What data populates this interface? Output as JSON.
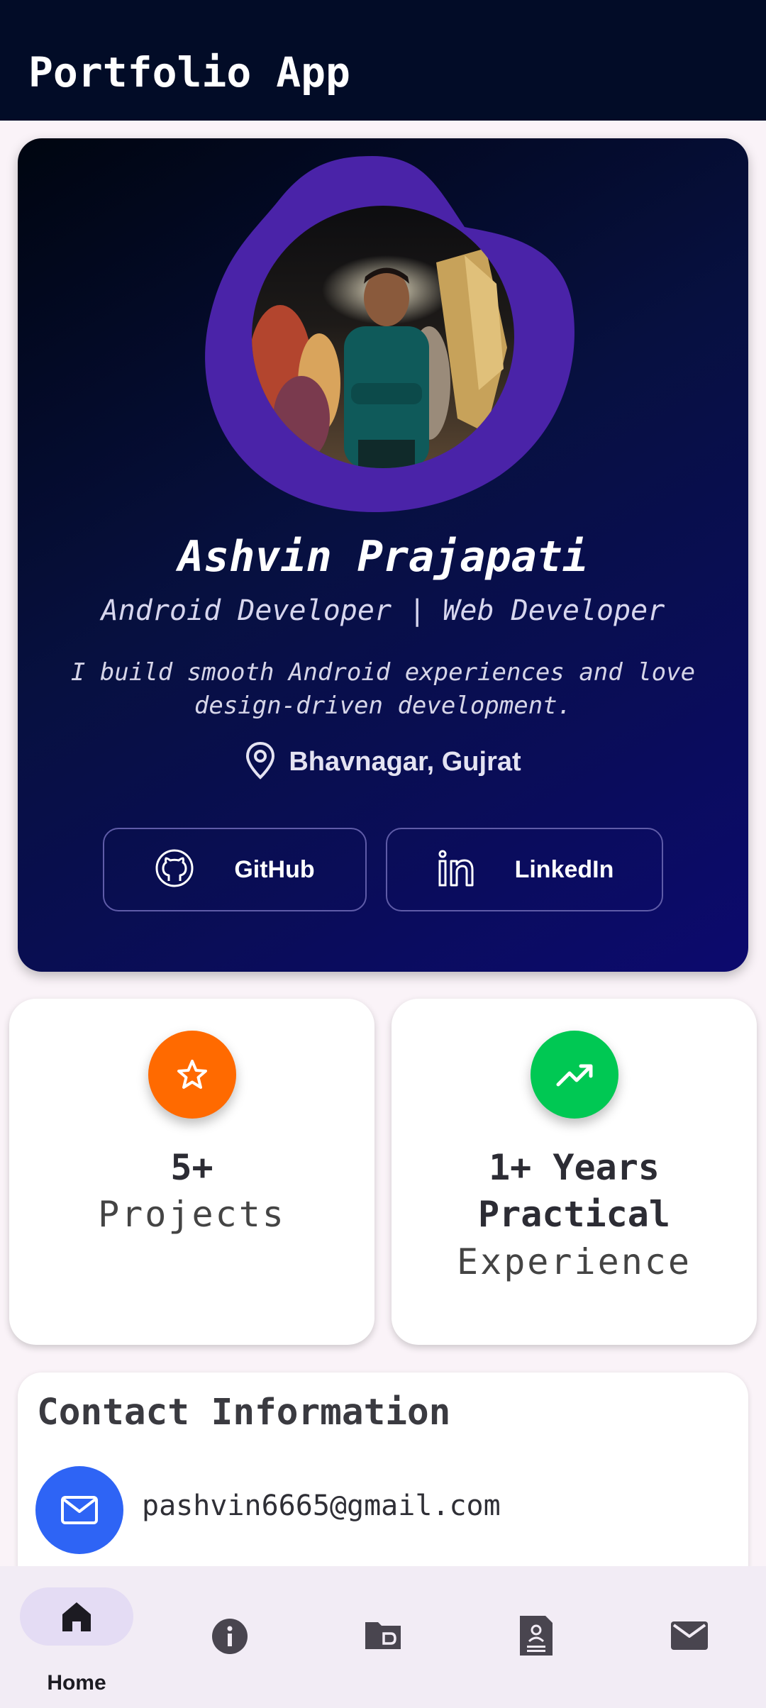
{
  "app_bar": {
    "title": "Portfolio App"
  },
  "profile": {
    "name": "Ashvin Prajapati",
    "role": "Android Developer | Web Developer",
    "bio": "I build smooth Android experiences and love design-driven development.",
    "location": "Bhavnagar, Gujrat",
    "icons": {
      "location": "location-pin-icon"
    },
    "links": [
      {
        "label": "GitHub",
        "icon": "github-icon"
      },
      {
        "label": "LinkedIn",
        "icon": "linkedin-icon"
      }
    ],
    "colors": {
      "blob": "#4a23a8",
      "card_gradient_end": "#0c0a6e"
    }
  },
  "stats": [
    {
      "main": "5+",
      "sub": "Projects",
      "icon": "star-icon",
      "color": "#ff6a00"
    },
    {
      "main_lines": [
        "1+ Years",
        "Practical"
      ],
      "sub": "Experience",
      "icon": "trending-up-icon",
      "color": "#00c853"
    }
  ],
  "contact": {
    "title": "Contact Information",
    "email": "pashvin6665@gmail.com",
    "email_icon": "mail-icon",
    "icon_color": "#2e64f5"
  },
  "bottom_nav": {
    "items": [
      {
        "label": "Home",
        "icon": "home-icon",
        "selected": true
      },
      {
        "label": "",
        "icon": "info-icon",
        "selected": false
      },
      {
        "label": "",
        "icon": "folder-icon",
        "selected": false
      },
      {
        "label": "",
        "icon": "resume-icon",
        "selected": false
      },
      {
        "label": "",
        "icon": "mail-icon",
        "selected": false
      }
    ]
  }
}
